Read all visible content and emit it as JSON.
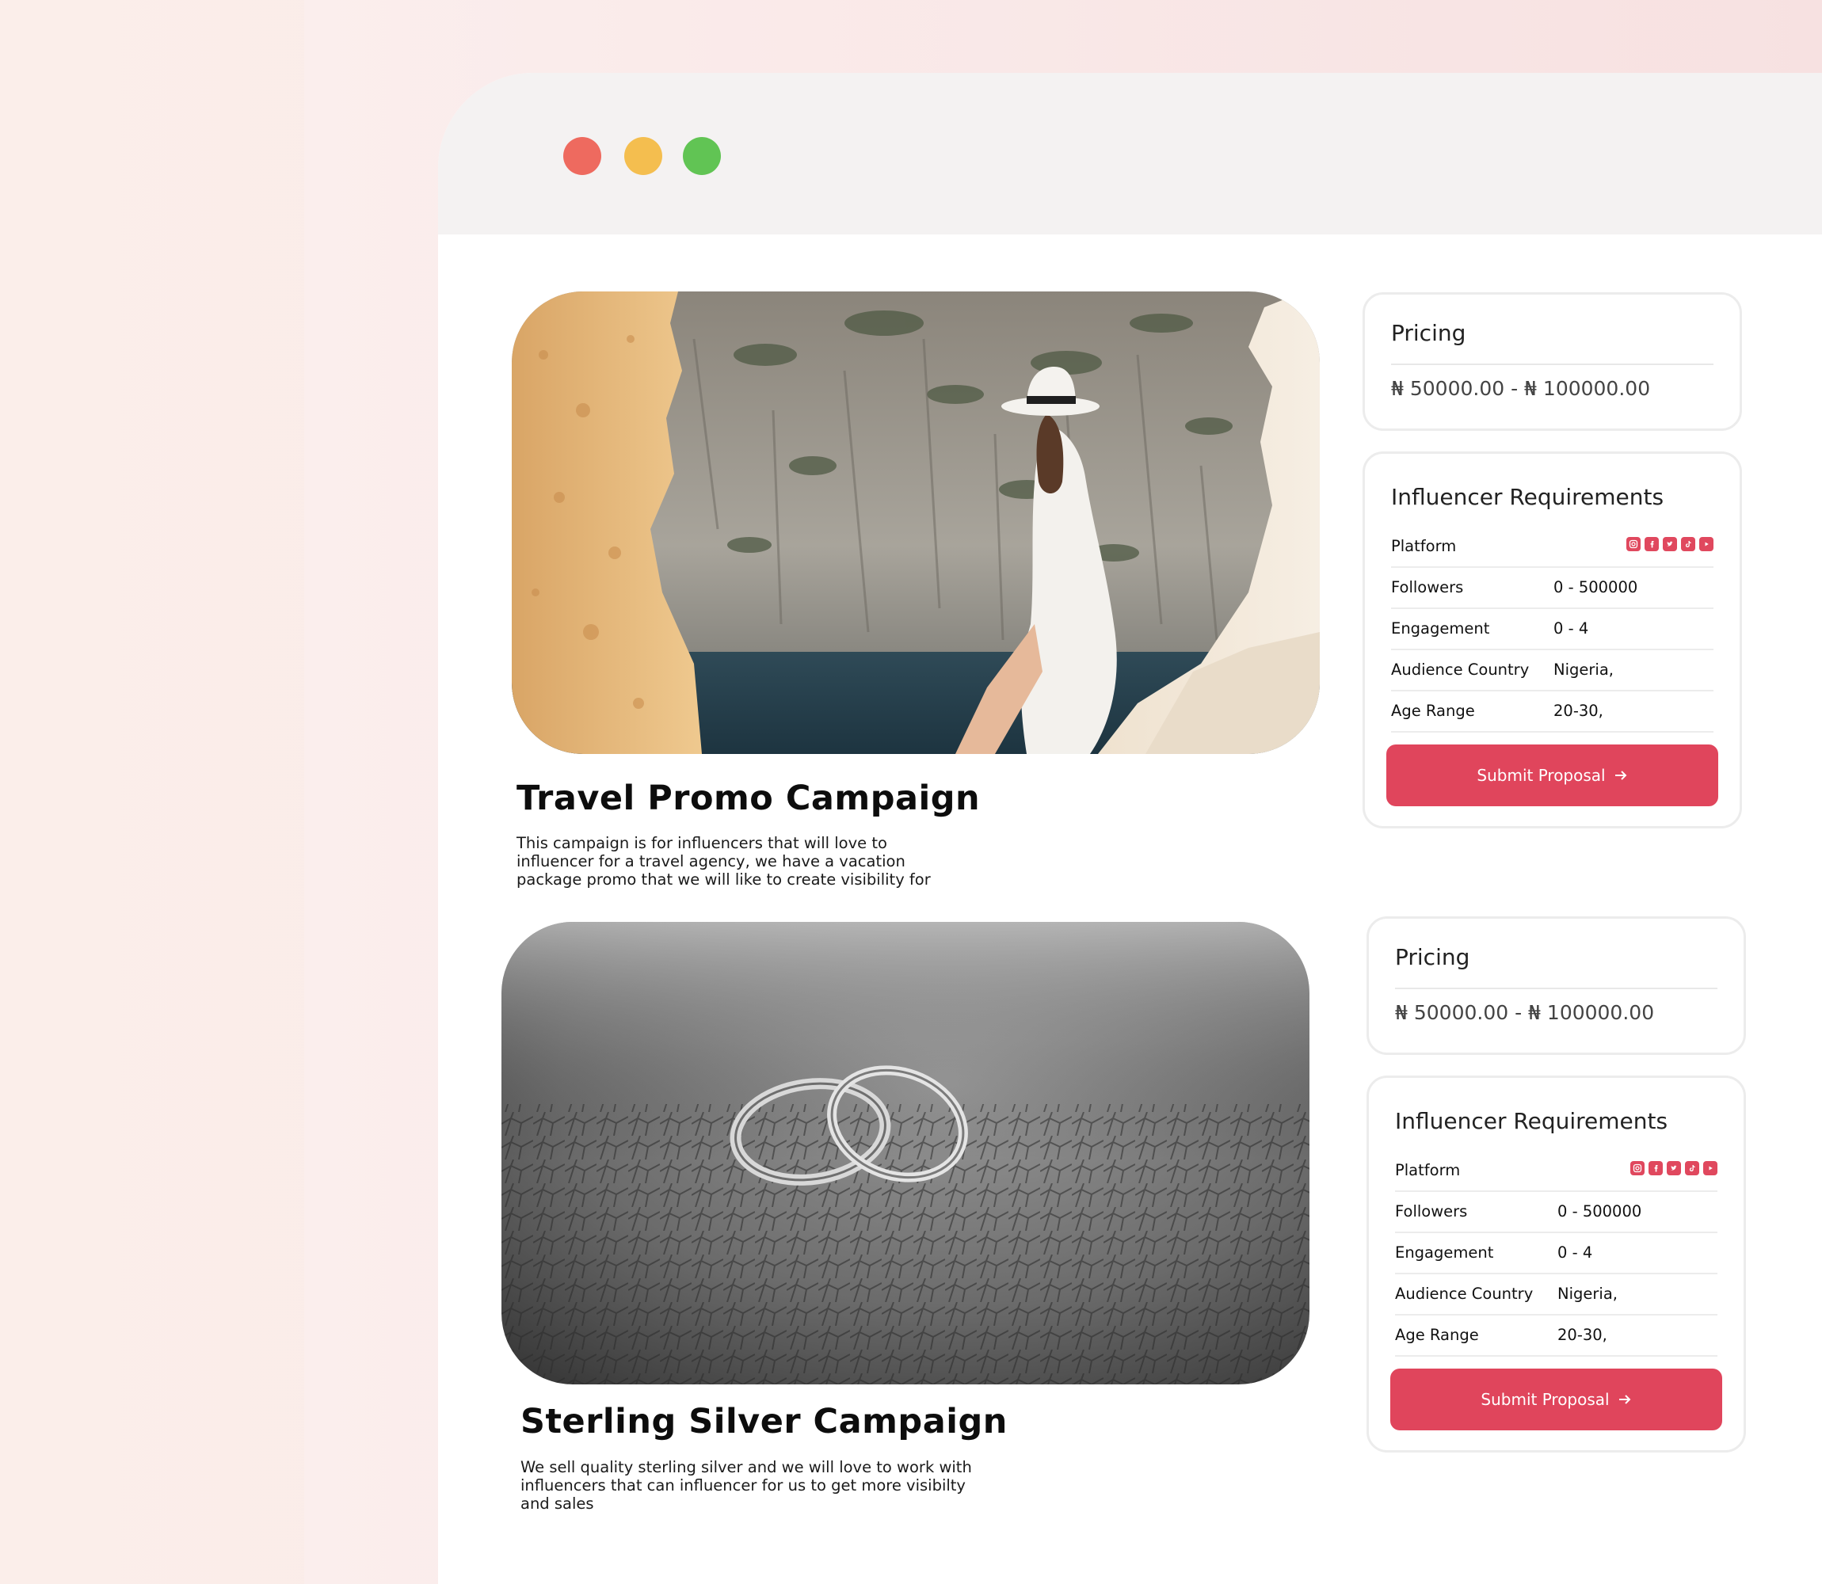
{
  "colors": {
    "accent": "#e0455c",
    "window_red": "#ee6a5f",
    "window_yellow": "#f4be4f",
    "window_green": "#61c454"
  },
  "campaigns": [
    {
      "title": "Travel Promo Campaign",
      "description": "This campaign is for influencers that will love to influencer for a travel agency, we have a vacation package promo that we will like to create visibility for",
      "pricing": {
        "title": "Pricing",
        "range": "₦ 50000.00 - ₦ 100000.00"
      },
      "requirements": {
        "title": "Influencer Requirements",
        "platform_label": "Platform",
        "platform_icons": [
          "instagram-icon",
          "facebook-icon",
          "twitter-icon",
          "tiktok-icon",
          "youtube-icon"
        ],
        "rows": [
          {
            "label": "Followers",
            "value": "0 - 500000"
          },
          {
            "label": "Engagement",
            "value": "0 - 4"
          },
          {
            "label": "Audience Country",
            "value": "Nigeria,"
          },
          {
            "label": "Age Range",
            "value": "20-30,"
          }
        ],
        "submit_label": "Submit Proposal"
      }
    },
    {
      "title": "Sterling Silver Campaign",
      "description": "We sell quality sterling silver and we will love to work with influencers that can influencer for us to get more visibilty and sales",
      "pricing": {
        "title": "Pricing",
        "range": "₦ 50000.00 - ₦ 100000.00"
      },
      "requirements": {
        "title": "Influencer Requirements",
        "platform_label": "Platform",
        "platform_icons": [
          "instagram-icon",
          "facebook-icon",
          "twitter-icon",
          "tiktok-icon",
          "youtube-icon"
        ],
        "rows": [
          {
            "label": "Followers",
            "value": "0 - 500000"
          },
          {
            "label": "Engagement",
            "value": "0 - 4"
          },
          {
            "label": "Audience Country",
            "value": "Nigeria,"
          },
          {
            "label": "Age Range",
            "value": "20-30,"
          }
        ],
        "submit_label": "Submit Proposal"
      }
    }
  ]
}
